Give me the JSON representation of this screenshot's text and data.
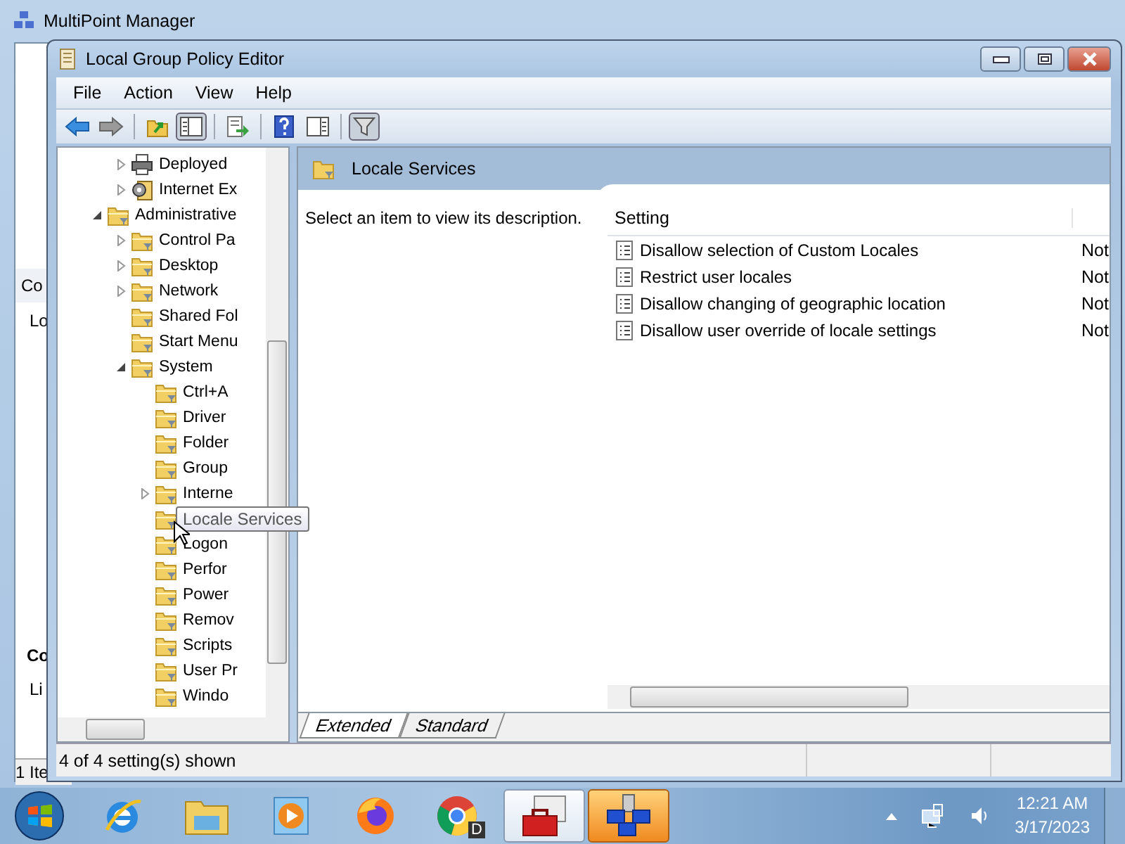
{
  "background_window": {
    "title": "MultiPoint Manager",
    "texts": [
      {
        "kind": "header",
        "text": "Co"
      },
      {
        "kind": "row",
        "text": "Lo"
      },
      {
        "kind": "bold",
        "text": "Co"
      },
      {
        "kind": "row",
        "text": "Li"
      },
      {
        "kind": "status",
        "text": "1 Ite"
      }
    ]
  },
  "window": {
    "title": "Local Group Policy Editor"
  },
  "menu": [
    "File",
    "Action",
    "View",
    "Help"
  ],
  "toolbar": [
    {
      "kind": "back"
    },
    {
      "kind": "forward"
    },
    {
      "kind": "separator"
    },
    {
      "kind": "up"
    },
    {
      "kind": "tree",
      "pressed": true
    },
    {
      "kind": "separator"
    },
    {
      "kind": "export"
    },
    {
      "kind": "separator"
    },
    {
      "kind": "help"
    },
    {
      "kind": "pane",
      "pressed": false
    },
    {
      "kind": "separator"
    },
    {
      "kind": "filter",
      "pressed": true
    }
  ],
  "tree": [
    {
      "children": [
        {
          "label": "Deployed",
          "expanded": false,
          "kind": "printer"
        },
        {
          "label": "Internet Ex",
          "expanded": false,
          "kind": "settings"
        }
      ]
    },
    {
      "label": "Administrative",
      "expanded": true,
      "children": [
        {
          "label": "Control Pa",
          "expanded": false
        },
        {
          "label": "Desktop",
          "expanded": false
        },
        {
          "label": "Network",
          "expanded": false
        },
        {
          "label": "Shared Fol"
        },
        {
          "label": "Start Menu"
        },
        {
          "label": "System",
          "expanded": true,
          "children": [
            {
              "label": "Ctrl+A"
            },
            {
              "label": "Driver"
            },
            {
              "label": "Folder"
            },
            {
              "label": "Group"
            },
            {
              "label": "Interne",
              "expanded": false
            },
            {
              "tooltip": "Locale Services"
            },
            {
              "label": "Logon"
            },
            {
              "label": "Perfor"
            },
            {
              "label": "Power"
            },
            {
              "label": "Remov"
            },
            {
              "label": "Scripts"
            },
            {
              "label": "User Pr"
            },
            {
              "label": "Windo"
            }
          ]
        }
      ]
    }
  ],
  "details": {
    "title": "Locale Services",
    "description": "Select an item to view its description.",
    "columns": [
      "Setting"
    ],
    "rows": [
      {
        "setting": "Disallow selection of Custom Locales",
        "column_2": "Not"
      },
      {
        "setting": "Restrict user locales",
        "column_2": "Not"
      },
      {
        "setting": "Disallow changing of geographic location",
        "column_2": "Not"
      },
      {
        "setting": "Disallow user override of locale settings",
        "column_2": "Not"
      }
    ],
    "tabs": [
      {
        "label": "Extended",
        "selected": true
      },
      {
        "label": "Standard",
        "selected": false
      }
    ]
  },
  "status_bar": {
    "text": "4 of 4 setting(s) shown"
  },
  "taskbar": {
    "apps": [
      {
        "kind": "ie",
        "active": false,
        "flashing": false
      },
      {
        "kind": "explorer",
        "active": false,
        "flashing": false
      },
      {
        "kind": "media",
        "active": false,
        "flashing": false
      },
      {
        "kind": "firefox",
        "active": false,
        "flashing": false
      },
      {
        "kind": "chrome",
        "active": false,
        "flashing": false,
        "badge": "D"
      },
      {
        "kind": "toolbox",
        "active": true,
        "flashing": false
      },
      {
        "kind": "network",
        "active": false,
        "flashing": true
      }
    ],
    "clock": {
      "time": "12:21 AM",
      "date": "3/17/2023"
    }
  }
}
